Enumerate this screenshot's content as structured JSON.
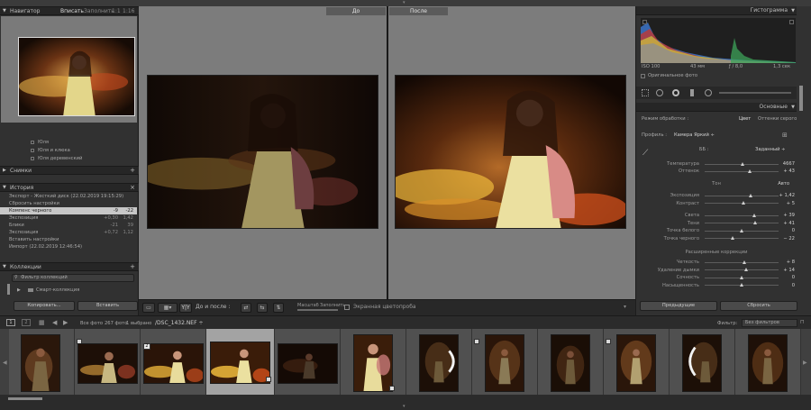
{
  "navigator": {
    "title": "Навигатор",
    "zoom_fit": "Вписать",
    "zoom_fill": "Заполнить",
    "zoom_1": "1:1",
    "zoom_other": "1:16 ÷"
  },
  "collection_items": [
    {
      "label": "Юля"
    },
    {
      "label": "Юля и клюка"
    },
    {
      "label": "Юля деревенский"
    }
  ],
  "snapshots": {
    "title": "Снимки"
  },
  "history": {
    "title": "История",
    "items": [
      {
        "label": "Экспорт - Жесткий диск (22.02.2019 19:15:29)",
        "v1": "",
        "v2": ""
      },
      {
        "label": "Сбросить настройки",
        "v1": "",
        "v2": ""
      },
      {
        "label": "Компенс черного",
        "v1": "-9",
        "v2": "-22",
        "selected": true
      },
      {
        "label": "Экспозиция",
        "v1": "+0,30",
        "v2": "1,42"
      },
      {
        "label": "Блики",
        "v1": "-21",
        "v2": "39"
      },
      {
        "label": "Экспозиция",
        "v1": "+0,72",
        "v2": "1,12"
      },
      {
        "label": "Вставить настройки",
        "v1": "",
        "v2": ""
      },
      {
        "label": "Импорт (22.02.2019 12:46:54)",
        "v1": "",
        "v2": ""
      }
    ]
  },
  "collections": {
    "title": "Коллекции",
    "filter": "Фильтр коллекций",
    "smart": "Смарт-коллекция"
  },
  "left_buttons": {
    "copy": "Копировать...",
    "paste": "Вставить"
  },
  "view_captions": {
    "before": "До",
    "after": "После"
  },
  "toolbar": {
    "before_after": "До и после :",
    "zoom_label": "Масштаб",
    "fill_label": "Заполнить",
    "proof_label": "Экранная цветопроба"
  },
  "histogram": {
    "title": "Гистограмма",
    "iso": "ISO 100",
    "focal": "43 мм",
    "aperture": "ƒ / 8,0",
    "shutter": "1,3 сек",
    "original": "Оригинальное фото"
  },
  "basic": {
    "title": "Основные",
    "treatment_label": "Режим обработки :",
    "treatment_color": "Цвет",
    "treatment_bw": "Оттенки серого",
    "profile_label": "Профиль :",
    "profile_value": "Камера Яркий ÷",
    "wb_label": "ББ :",
    "wb_value": "Заданный ÷",
    "temperature": {
      "label": "Температура",
      "value": "4667",
      "pos": 0.52
    },
    "tint": {
      "label": "Оттенок",
      "value": "+ 43",
      "pos": 0.62
    },
    "tone_label": "Тон",
    "tone_auto": "Авто",
    "sliders_tone": [
      {
        "label": "Экспозиция",
        "value": "+ 1,42",
        "pos": 0.63
      },
      {
        "label": "Контраст",
        "value": "+ 5",
        "pos": 0.53
      }
    ],
    "sliders_tone2": [
      {
        "label": "Света",
        "value": "+ 39",
        "pos": 0.68
      },
      {
        "label": "Тени",
        "value": "+ 41",
        "pos": 0.69
      },
      {
        "label": "Точка белого",
        "value": "0",
        "pos": 0.5
      },
      {
        "label": "Точка черного",
        "value": "− 22",
        "pos": 0.39
      }
    ],
    "presence_label": "Расширенные коррекции",
    "sliders_presence": [
      {
        "label": "Четкость",
        "value": "+ 8",
        "pos": 0.54
      },
      {
        "label": "Удаление дымки",
        "value": "+ 14",
        "pos": 0.57
      },
      {
        "label": "Сочность",
        "value": "0",
        "pos": 0.5
      },
      {
        "label": "Насыщенность",
        "value": "0",
        "pos": 0.5
      }
    ]
  },
  "right_buttons": {
    "previous": "Предыдущие",
    "reset": "Сбросить"
  },
  "filmstrip_bar": {
    "all_photos": "Все фото",
    "count": "267 фото",
    "selected": "1 выбрано",
    "filename": "/DSC_1432.NEF ÷",
    "filter_label": "Фильтр:",
    "filter_value": "Без фильтров"
  },
  "thumb_badge": "2",
  "colors": {
    "panel": "#313131",
    "header": "#262626",
    "accent_bg": "#7c7c7c",
    "selected_thumb": "#a3a3a3"
  }
}
